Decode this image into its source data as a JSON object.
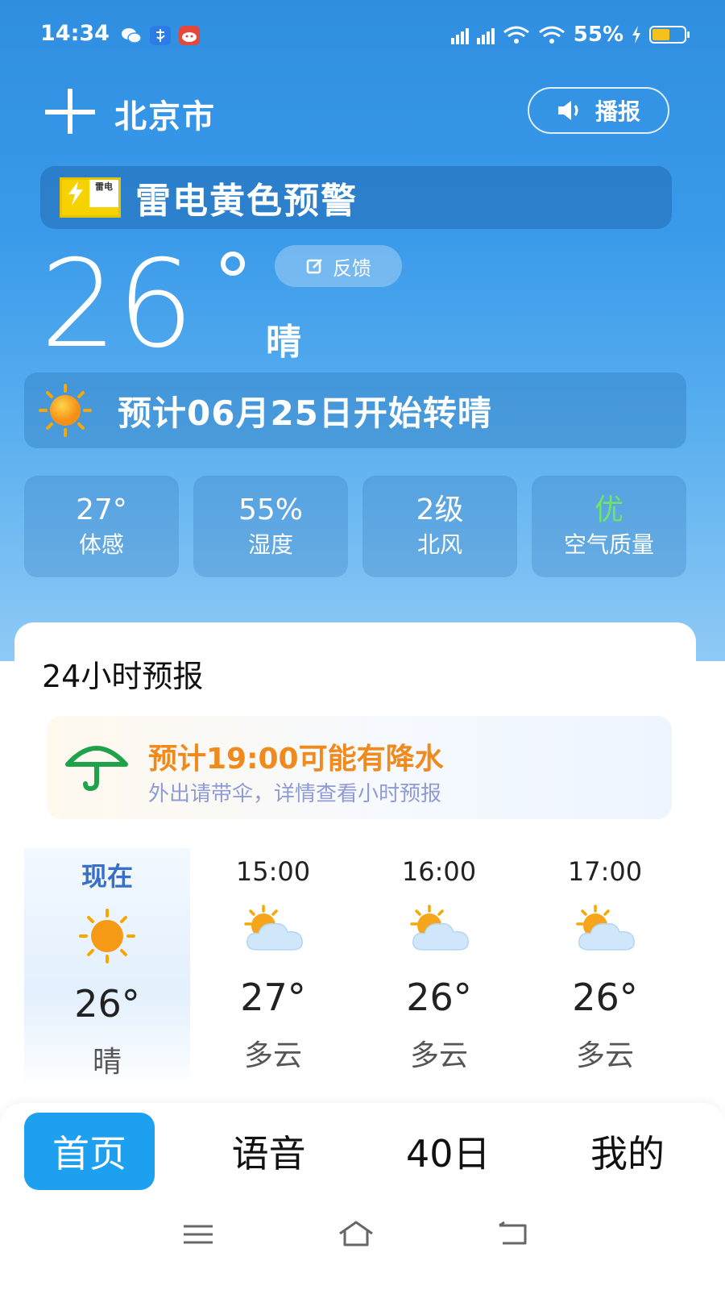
{
  "status_bar": {
    "time": "14:34",
    "battery_text": "55%",
    "battery_level": 0.55,
    "icons": [
      "wechat-icon",
      "alipay-icon",
      "app-icon",
      "signal-5g-icon",
      "signal-5g-icon",
      "wifi-icon",
      "wifi-icon",
      "charging-icon",
      "battery-icon"
    ]
  },
  "header": {
    "city": "北京市",
    "broadcast_label": "播报"
  },
  "warning": {
    "badge_text": "雷电",
    "badge_sub": "黄",
    "text": "雷电黄色预警",
    "color": "#f6d200"
  },
  "current": {
    "temperature": "26",
    "condition": "晴",
    "feedback_label": "反馈",
    "forecast_banner": "预计06月25日开始转晴"
  },
  "metrics": [
    {
      "value": "27°",
      "label": "体感"
    },
    {
      "value": "55%",
      "label": "湿度"
    },
    {
      "value": "2级",
      "label": "北风"
    },
    {
      "value": "优",
      "label": "空气质量"
    }
  ],
  "forecast24": {
    "title": "24小时预报",
    "rain_title": "预计19:00可能有降水",
    "rain_sub": "外出请带伞，详情查看小时预报",
    "hours": [
      {
        "time": "现在",
        "icon": "sun-icon",
        "temp": "26°",
        "cond": "晴"
      },
      {
        "time": "15:00",
        "icon": "partly-cloudy-icon",
        "temp": "27°",
        "cond": "多云"
      },
      {
        "time": "16:00",
        "icon": "partly-cloudy-icon",
        "temp": "26°",
        "cond": "多云"
      },
      {
        "time": "17:00",
        "icon": "partly-cloudy-icon",
        "temp": "26°",
        "cond": "多云"
      }
    ]
  },
  "nav": {
    "tabs": [
      "首页",
      "语音",
      "40日",
      "我的"
    ],
    "active": "首页",
    "accent": "#1ea0f0"
  }
}
